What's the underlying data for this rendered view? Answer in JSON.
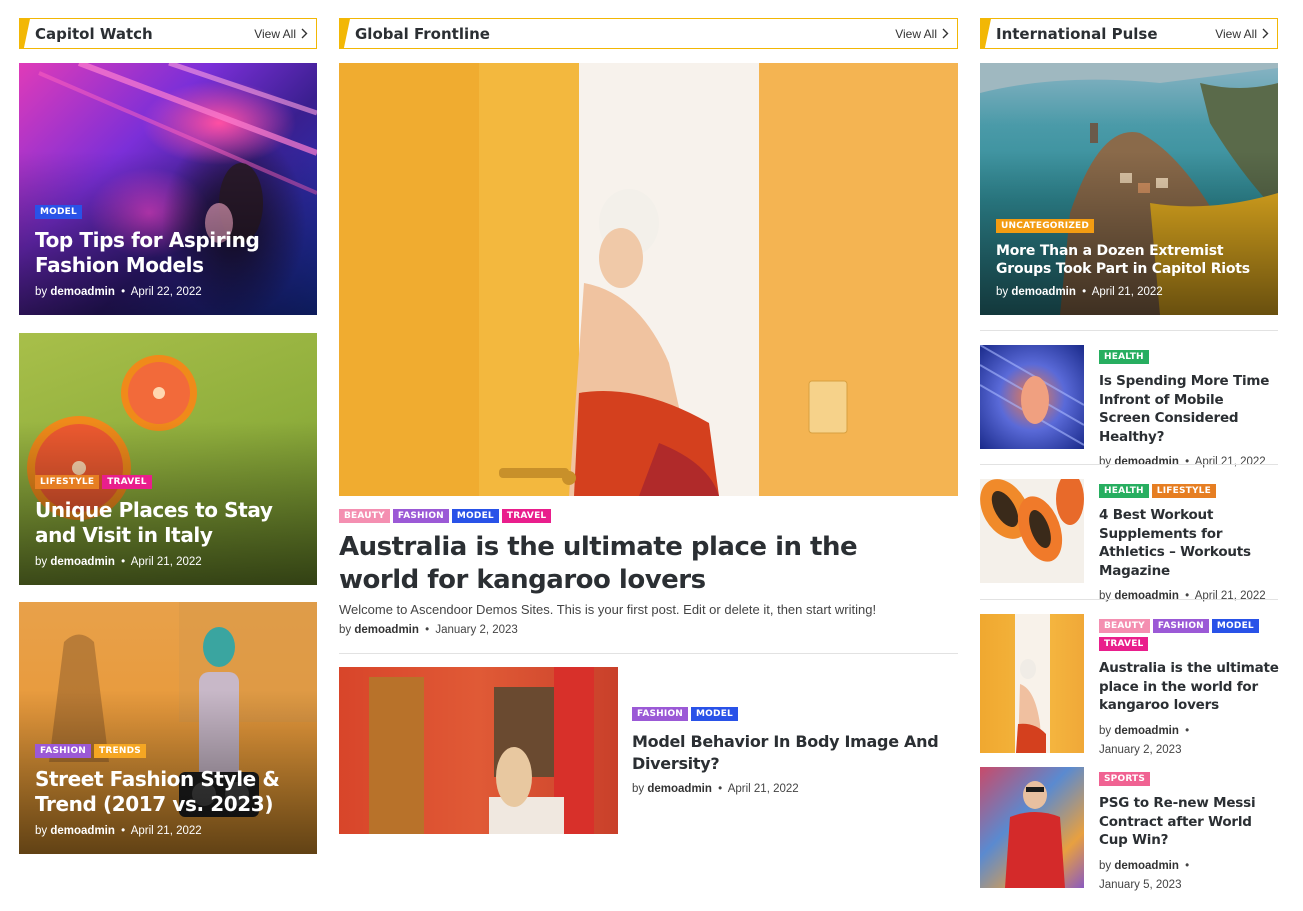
{
  "colors": {
    "accent": "#f2b705",
    "model": "#2952e8",
    "lifestyle": "#e67e22",
    "travel": "#e91e8c",
    "fashion": "#9b59d6",
    "trends": "#f5a623",
    "beauty": "#f48fb1",
    "health": "#27ae60",
    "uncategorized": "#f39c12",
    "sports": "#f06292"
  },
  "left": {
    "title": "Capitol Watch",
    "view_all": "View All",
    "cards": [
      {
        "cats": [
          "MODEL"
        ],
        "title": "Top Tips for Aspiring Fashion Models",
        "by": "by",
        "author": "demoadmin",
        "date": "April 22, 2022"
      },
      {
        "cats": [
          "LIFESTYLE",
          "TRAVEL"
        ],
        "title": "Unique Places to Stay and Visit in Italy",
        "by": "by",
        "author": "demoadmin",
        "date": "April 21, 2022"
      },
      {
        "cats": [
          "FASHION",
          "TRENDS"
        ],
        "title": "Street Fashion Style & Trend (2017 vs. 2023)",
        "by": "by",
        "author": "demoadmin",
        "date": "April 21, 2022"
      }
    ]
  },
  "middle": {
    "title": "Global Frontline",
    "view_all": "View All",
    "feature": {
      "cats": [
        "BEAUTY",
        "FASHION",
        "MODEL",
        "TRAVEL"
      ],
      "title": "Australia is the ultimate place in the world for kangaroo lovers",
      "excerpt": "Welcome to Ascendoor Demos Sites. This is your first post. Edit or delete it, then start writing!",
      "by": "by",
      "author": "demoadmin",
      "date": "January 2, 2023"
    },
    "secondary": {
      "cats": [
        "FASHION",
        "MODEL"
      ],
      "title": "Model Behavior In Body Image And Diversity?",
      "by": "by",
      "author": "demoadmin",
      "date": "April 21, 2022"
    }
  },
  "right": {
    "title": "International Pulse",
    "view_all": "View All",
    "feature": {
      "cats": [
        "UNCATEGORIZED"
      ],
      "title": "More Than a Dozen Extremist Groups Took Part in Capitol Riots",
      "by": "by",
      "author": "demoadmin",
      "date": "April 21, 2022"
    },
    "items": [
      {
        "cats": [
          "HEALTH"
        ],
        "title": "Is Spending More Time Infront of Mobile Screen Considered Healthy?",
        "by": "by",
        "author": "demoadmin",
        "date": "April 21, 2022"
      },
      {
        "cats": [
          "HEALTH",
          "LIFESTYLE"
        ],
        "title": "4 Best Workout Supplements for Athletics – Workouts Magazine",
        "by": "by",
        "author": "demoadmin",
        "date": "April 21, 2022"
      },
      {
        "cats": [
          "BEAUTY",
          "FASHION",
          "MODEL",
          "TRAVEL"
        ],
        "title": "Australia is the ultimate place in the world for kangaroo lovers",
        "by": "by",
        "author": "demoadmin",
        "date": "January 2, 2023"
      },
      {
        "cats": [
          "SPORTS"
        ],
        "title": "PSG to Re-new Messi Contract after World Cup Win?",
        "by": "by",
        "author": "demoadmin",
        "date": "January 5, 2023"
      }
    ]
  }
}
